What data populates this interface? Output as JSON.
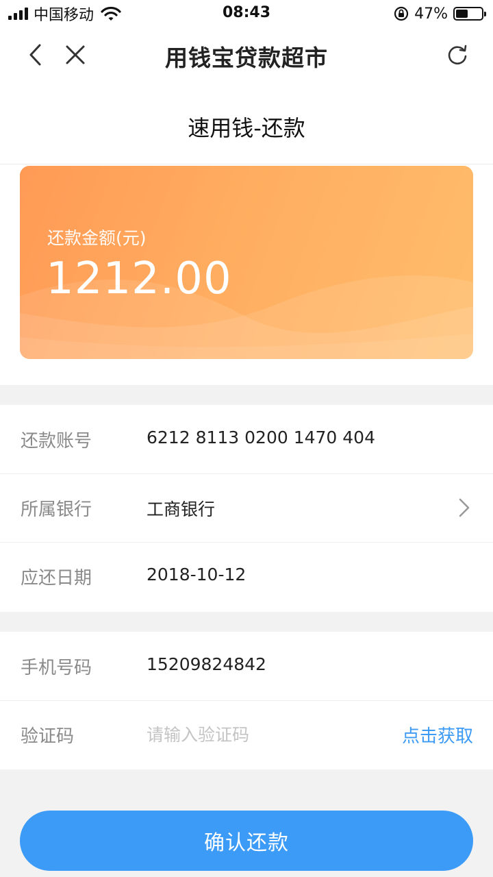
{
  "status_bar": {
    "carrier": "中国移动",
    "time": "08:43",
    "battery_percent": "47%",
    "battery_level": 0.47,
    "icons": [
      "signal-icon",
      "wifi-icon",
      "rotation-lock-icon",
      "battery-icon"
    ]
  },
  "nav": {
    "title": "用钱宝贷款超市",
    "icons": [
      "back-icon",
      "close-icon",
      "refresh-icon"
    ]
  },
  "subtitle": "速用钱-还款",
  "amount": {
    "label": "还款金额(元)",
    "value": "1212.00"
  },
  "details": {
    "account_label": "还款账号",
    "account_value": "6212 8113 0200 1470 404",
    "bank_label": "所属银行",
    "bank_value": "工商银行",
    "due_label": "应还日期",
    "due_value": "2018-10-12"
  },
  "verify": {
    "phone_label": "手机号码",
    "phone_value": "15209824842",
    "code_label": "验证码",
    "code_placeholder": "请输入验证码",
    "code_value": "",
    "get_code_label": "点击获取"
  },
  "confirm_label": "确认还款",
  "colors": {
    "accent": "#3d9bf8",
    "link": "#3d9bf5",
    "card_start": "#ff9a55",
    "card_end": "#ffbd6b"
  }
}
